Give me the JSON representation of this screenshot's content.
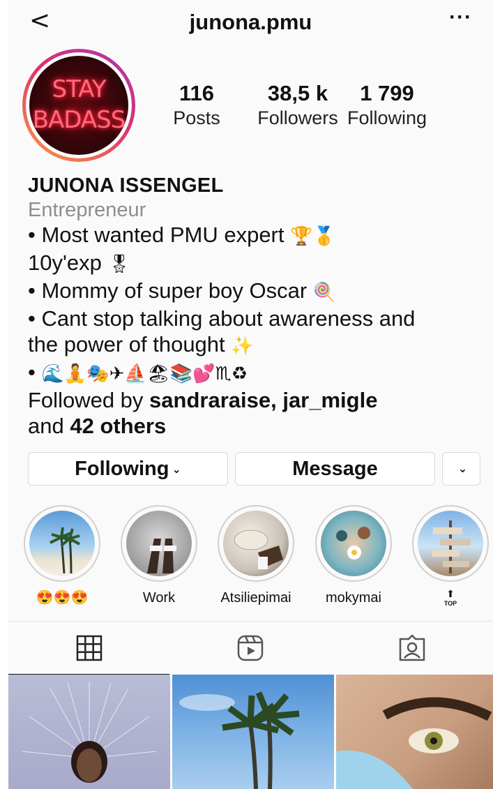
{
  "header": {
    "back_icon": "chevron-left-icon",
    "username": "junona.pmu",
    "more_icon": "ellipsis-icon",
    "more_label": "···"
  },
  "profile": {
    "avatar_text_line1": "STAY",
    "avatar_text_line2": "BADASS",
    "stats": [
      {
        "value": "116",
        "label": "Posts"
      },
      {
        "value": "38,5 k",
        "label": "Followers"
      },
      {
        "value": "1 799",
        "label": "Following"
      }
    ]
  },
  "bio": {
    "name": "JUNONA ISSENGEL",
    "category": "Entrepreneur",
    "line1": "• Most wanted PMU expert",
    "line1_emoji": "🏆🥇",
    "line2": "10y'exp",
    "line2_emoji": "🎖",
    "line3": "• Mommy of super boy Oscar",
    "line3_emoji": "🍭",
    "line4": "• Cant stop talking about awareness and",
    "line5": "the power of thought",
    "line5_emoji": "✨",
    "line6_bullet": "•",
    "line6_emoji": "🌊🧘🎭✈⛵🏖📚💕♏♻",
    "followed_prefix": "Followed by",
    "followed_users": "sandraraise, jar_migle",
    "followed_and": "and",
    "followed_others": "42 others"
  },
  "buttons": {
    "following": "Following",
    "following_icon": "chevron-down-icon",
    "message": "Message",
    "dropdown_icon": "chevron-down-icon"
  },
  "highlights": [
    {
      "label": "😍😍😍"
    },
    {
      "label": "Work"
    },
    {
      "label": "Atsiliepimai"
    },
    {
      "label": "mokymai"
    },
    {
      "label": "TOP"
    }
  ],
  "tabs": [
    {
      "icon": "grid-icon"
    },
    {
      "icon": "reels-icon"
    },
    {
      "icon": "tagged-icon"
    }
  ]
}
